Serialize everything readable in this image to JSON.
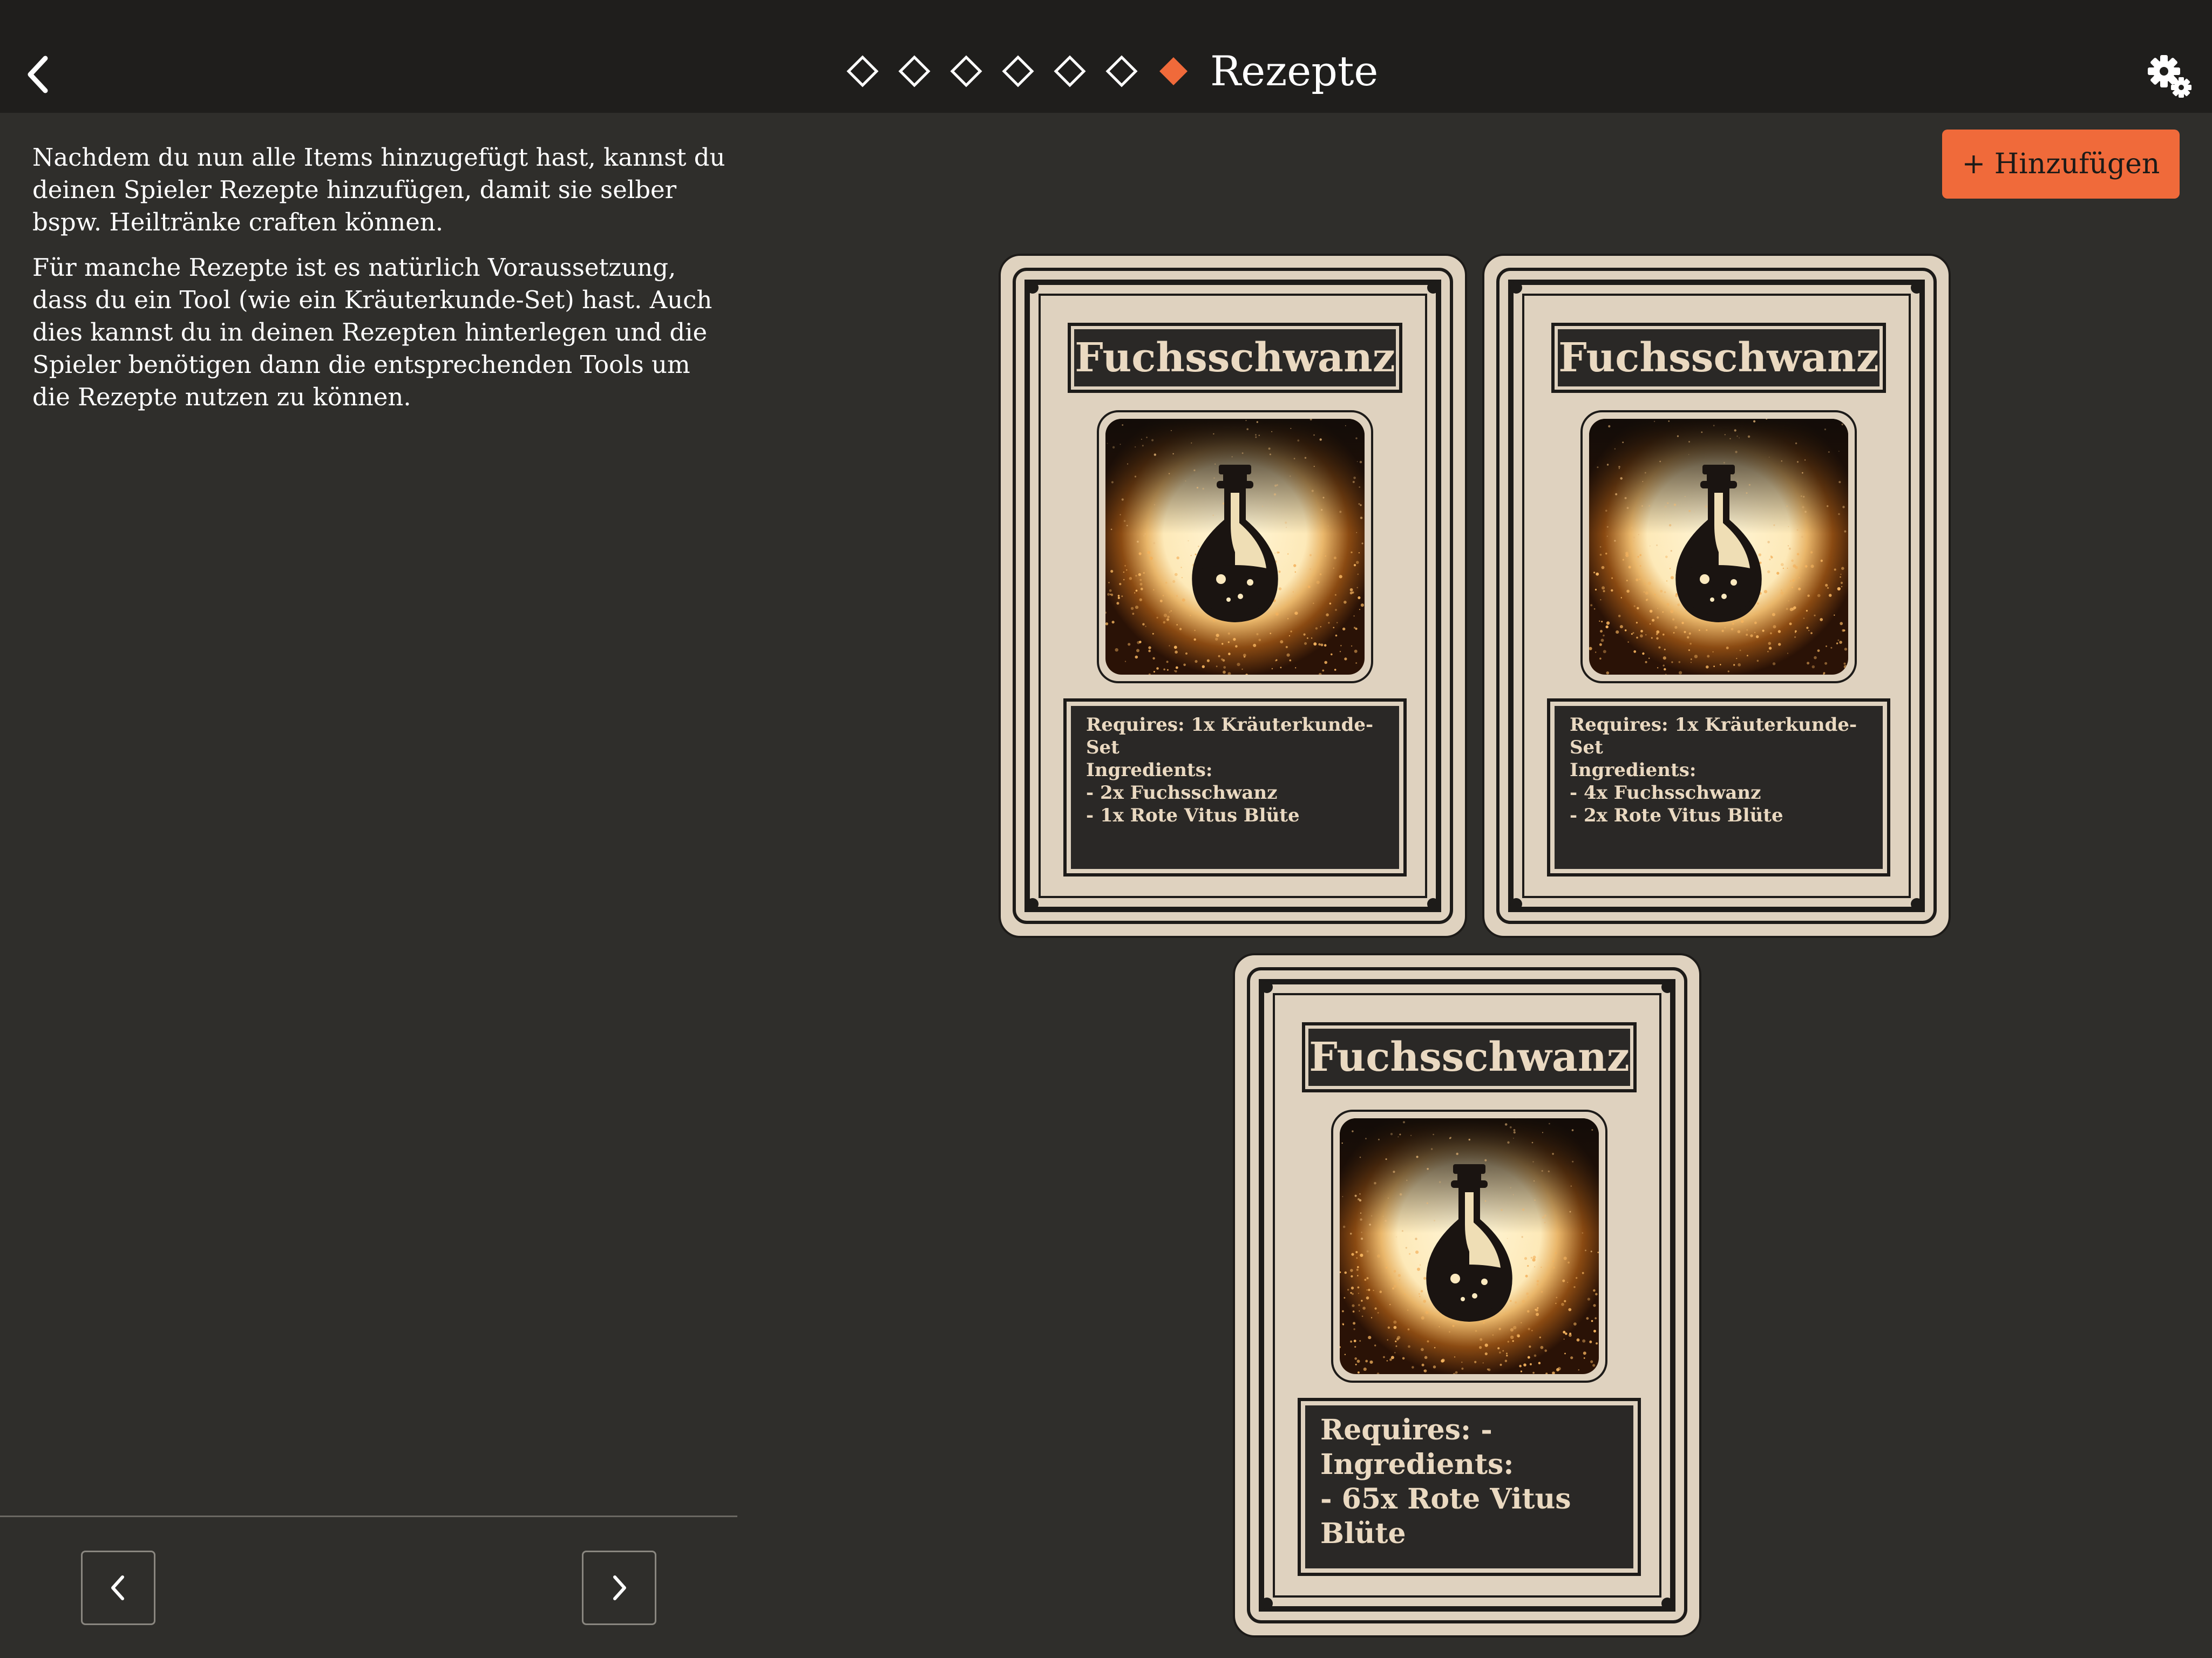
{
  "header": {
    "back_icon": "chevron-left-icon",
    "steps": [
      {
        "state": "incomplete"
      },
      {
        "state": "incomplete"
      },
      {
        "state": "incomplete"
      },
      {
        "state": "incomplete"
      },
      {
        "state": "incomplete"
      },
      {
        "state": "incomplete"
      },
      {
        "state": "current"
      }
    ],
    "title": "Rezepte",
    "settings_icon": "gears-icon",
    "accent_color": "#f06a3a"
  },
  "description": {
    "paragraph_1": "Nachdem du nun alle Items hinzugefügt hast, kannst du deinen Spieler Rezepte hinzufügen, damit sie selber bspw. Heiltränke craften können.",
    "paragraph_2": "Für manche Rezepte ist es natürlich Voraussetzung, dass du ein Tool (wie ein Kräuterkunde-Set) hast. Auch dies kannst du in deinen Rezepten hinterlegen und die Spieler benötigen dann die entsprechenden Tools um die Rezepte nutzen zu können."
  },
  "add_button": {
    "label": "+ Hinzufügen"
  },
  "footer": {
    "prev_icon": "chevron-left-icon",
    "next_icon": "chevron-right-icon"
  },
  "recipes": [
    {
      "title": "Fuchsschwanz",
      "image_icon": "potion-bottle-icon",
      "lines": [
        "Requires: 1x Kräuterkunde-Set",
        "Ingredients:",
        "- 2x Fuchsschwanz",
        "- 1x Rote Vitus Blüte"
      ]
    },
    {
      "title": "Fuchsschwanz",
      "image_icon": "potion-bottle-icon",
      "lines": [
        "Requires: 1x Kräuterkunde-Set",
        "Ingredients:",
        "- 4x Fuchsschwanz",
        "- 2x Rote Vitus Blüte"
      ]
    },
    {
      "title": "Fuchsschwanz",
      "image_icon": "potion-bottle-icon",
      "lines": [
        "Requires: -",
        "Ingredients:",
        "- 65x Rote Vitus Blüte"
      ]
    }
  ]
}
